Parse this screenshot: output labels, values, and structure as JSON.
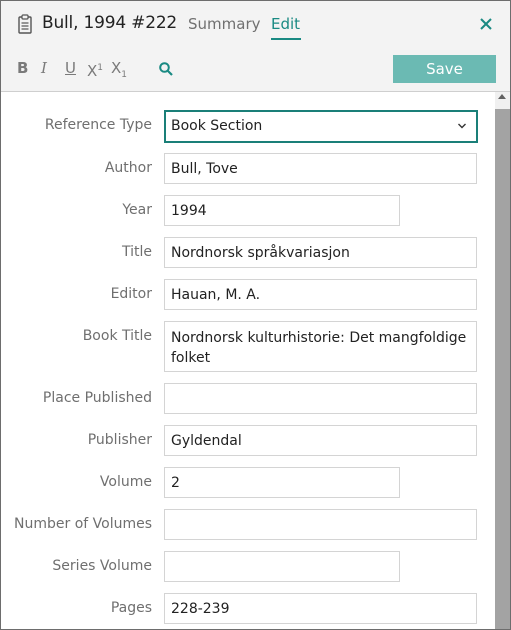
{
  "header": {
    "reference_title": "Bull, 1994 #222",
    "tabs": [
      {
        "label": "Summary",
        "active": false
      },
      {
        "label": "Edit",
        "active": true
      }
    ],
    "close_icon": "close-icon",
    "accent_color": "#1a8a83"
  },
  "toolbar": {
    "bold": "B",
    "italic": "I",
    "underline": "U",
    "superscript": "X",
    "superscript_mark": "1",
    "subscript": "X",
    "subscript_mark": "1",
    "search_icon": "search-icon",
    "save_label": "Save",
    "save_color": "#6bbab3"
  },
  "form": {
    "reference_type": {
      "label": "Reference Type",
      "value": "Book Section"
    },
    "author": {
      "label": "Author",
      "value": "Bull, Tove"
    },
    "year": {
      "label": "Year",
      "value": "1994"
    },
    "title": {
      "label": "Title",
      "value": "Nordnorsk språkvariasjon"
    },
    "editor": {
      "label": "Editor",
      "value": "Hauan, M. A."
    },
    "book_title": {
      "label": "Book Title",
      "value": "Nordnorsk kulturhistorie: Det mangfoldige folket"
    },
    "place_published": {
      "label": "Place Published",
      "value": ""
    },
    "publisher": {
      "label": "Publisher",
      "value": "Gyldendal"
    },
    "volume": {
      "label": "Volume",
      "value": "2"
    },
    "number_of_volumes": {
      "label": "Number of Volumes",
      "value": ""
    },
    "series_volume": {
      "label": "Series Volume",
      "value": ""
    },
    "pages": {
      "label": "Pages",
      "value": "228-239"
    }
  }
}
